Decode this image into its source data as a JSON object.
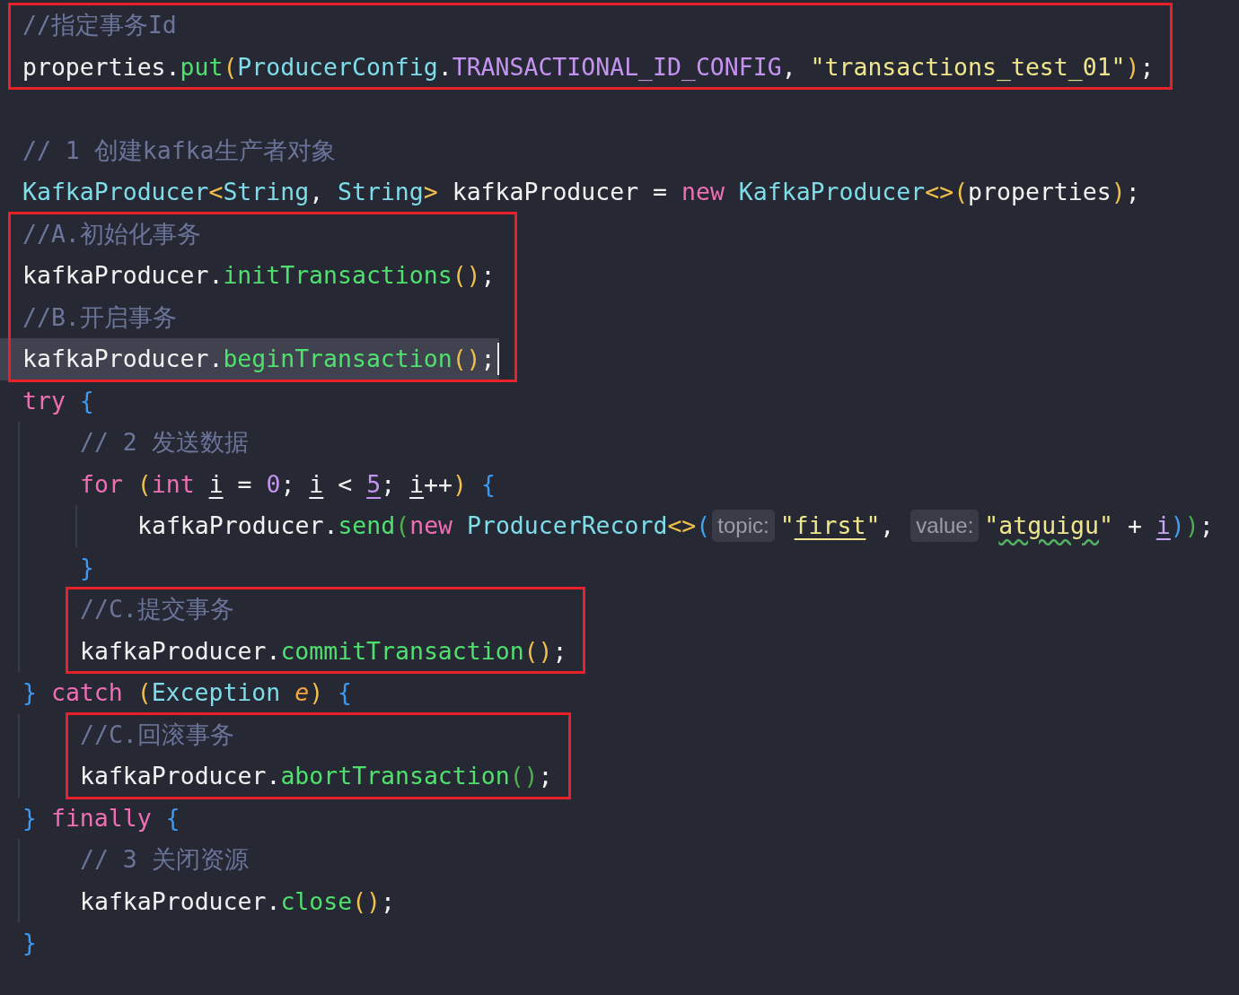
{
  "editor": {
    "nodes": [
      {
        "kind": "boxed",
        "lines": [
          {
            "kind": "line",
            "tokens": [
              {
                "kind": "comment",
                "text": "//指定事务Id"
              }
            ]
          },
          {
            "kind": "line",
            "tokens": [
              {
                "kind": "plain",
                "text": "properties."
              },
              {
                "kind": "method",
                "text": "put"
              },
              {
                "kind": "paren",
                "text": "("
              },
              {
                "kind": "type",
                "text": "ProducerConfig"
              },
              {
                "kind": "plain",
                "text": "."
              },
              {
                "kind": "const",
                "text": "TRANSACTIONAL_ID_CONFIG"
              },
              {
                "kind": "plain",
                "text": ", "
              },
              {
                "kind": "string",
                "text": "\"transactions_test_01\""
              },
              {
                "kind": "paren",
                "text": ")"
              },
              {
                "kind": "plain",
                "text": ";"
              }
            ]
          }
        ]
      },
      {
        "kind": "blank"
      },
      {
        "kind": "line",
        "tokens": [
          {
            "kind": "comment",
            "text": "// 1 创建kafka生产者对象"
          }
        ]
      },
      {
        "kind": "line",
        "tokens": [
          {
            "kind": "type",
            "text": "KafkaProducer"
          },
          {
            "kind": "paren",
            "text": "<"
          },
          {
            "kind": "type",
            "text": "String"
          },
          {
            "kind": "plain",
            "text": ", "
          },
          {
            "kind": "type",
            "text": "String"
          },
          {
            "kind": "paren",
            "text": ">"
          },
          {
            "kind": "plain",
            "text": " kafkaProducer = "
          },
          {
            "kind": "keyword",
            "text": "new"
          },
          {
            "kind": "type",
            "text": " KafkaProducer"
          },
          {
            "kind": "paren",
            "text": "<>("
          },
          {
            "kind": "plain",
            "text": "properties"
          },
          {
            "kind": "paren",
            "text": ")"
          },
          {
            "kind": "plain",
            "text": ";"
          }
        ]
      },
      {
        "kind": "boxed",
        "lines": [
          {
            "kind": "line",
            "tokens": [
              {
                "kind": "comment",
                "text": "//A.初始化事务"
              }
            ]
          },
          {
            "kind": "line",
            "tokens": [
              {
                "kind": "plain",
                "text": "kafkaProducer."
              },
              {
                "kind": "method",
                "text": "initTransactions"
              },
              {
                "kind": "paren",
                "text": "()"
              },
              {
                "kind": "plain",
                "text": ";"
              }
            ]
          },
          {
            "kind": "line",
            "tokens": [
              {
                "kind": "comment",
                "text": "//B.开启事务"
              }
            ]
          },
          {
            "kind": "line",
            "current": true,
            "cursor": true,
            "tokens": [
              {
                "kind": "plain",
                "text": "kafkaProducer."
              },
              {
                "kind": "method",
                "text": "beginTransaction"
              },
              {
                "kind": "paren",
                "text": "()"
              },
              {
                "kind": "plain",
                "text": ";"
              }
            ]
          }
        ]
      },
      {
        "kind": "line",
        "tokens": [
          {
            "kind": "keyword",
            "text": "try"
          },
          {
            "kind": "brace",
            "text": " {"
          }
        ],
        "children": [
          {
            "kind": "line",
            "tokens": [
              {
                "kind": "comment",
                "text": "// 2 发送数据"
              }
            ]
          },
          {
            "kind": "line",
            "tokens": [
              {
                "kind": "keyword",
                "text": "for"
              },
              {
                "kind": "paren",
                "text": " ("
              },
              {
                "kind": "keyword",
                "text": "int "
              },
              {
                "kind": "var",
                "text": "i",
                "underlined": true
              },
              {
                "kind": "plain",
                "text": " = "
              },
              {
                "kind": "number",
                "text": "0"
              },
              {
                "kind": "plain",
                "text": "; "
              },
              {
                "kind": "var",
                "text": "i",
                "underlined": true
              },
              {
                "kind": "plain",
                "text": " < "
              },
              {
                "kind": "number",
                "text": "5",
                "underlined": true
              },
              {
                "kind": "plain",
                "text": "; "
              },
              {
                "kind": "var",
                "text": "i",
                "underlined": true
              },
              {
                "kind": "plain",
                "text": "++"
              },
              {
                "kind": "paren",
                "text": ")"
              },
              {
                "kind": "brace",
                "text": " {"
              }
            ],
            "children": [
              {
                "kind": "line",
                "tokens": [
                  {
                    "kind": "plain",
                    "text": "kafkaProducer."
                  },
                  {
                    "kind": "method",
                    "text": "send"
                  },
                  {
                    "kind": "paren-green",
                    "text": "("
                  },
                  {
                    "kind": "keyword",
                    "text": "new"
                  },
                  {
                    "kind": "type",
                    "text": " ProducerRecord"
                  },
                  {
                    "kind": "paren",
                    "text": "<>"
                  },
                  {
                    "kind": "paren-blue",
                    "text": "("
                  },
                  {
                    "kind": "hint",
                    "text": "topic:"
                  },
                  {
                    "kind": "string",
                    "text": "\""
                  },
                  {
                    "kind": "string",
                    "text": "first",
                    "underlined": true
                  },
                  {
                    "kind": "string",
                    "text": "\""
                  },
                  {
                    "kind": "plain",
                    "text": ", "
                  },
                  {
                    "kind": "hint",
                    "text": "value:"
                  },
                  {
                    "kind": "string",
                    "text": "\""
                  },
                  {
                    "kind": "string",
                    "text": "atguigu",
                    "typo": true
                  },
                  {
                    "kind": "string",
                    "text": "\""
                  },
                  {
                    "kind": "plain",
                    "text": " + "
                  },
                  {
                    "kind": "local",
                    "text": "i",
                    "underlined": true
                  },
                  {
                    "kind": "paren-blue",
                    "text": ")"
                  },
                  {
                    "kind": "paren-green",
                    "text": ")"
                  },
                  {
                    "kind": "plain",
                    "text": ";"
                  }
                ]
              }
            ]
          },
          {
            "kind": "line",
            "tokens": [
              {
                "kind": "brace",
                "text": "}"
              }
            ]
          },
          {
            "kind": "boxed",
            "lines": [
              {
                "kind": "line",
                "tokens": [
                  {
                    "kind": "comment",
                    "text": "//C.提交事务"
                  }
                ]
              },
              {
                "kind": "line",
                "tokens": [
                  {
                    "kind": "plain",
                    "text": "kafkaProducer."
                  },
                  {
                    "kind": "method",
                    "text": "commitTransaction"
                  },
                  {
                    "kind": "paren",
                    "text": "()"
                  },
                  {
                    "kind": "plain",
                    "text": ";"
                  }
                ]
              }
            ]
          }
        ]
      },
      {
        "kind": "line",
        "tokens": [
          {
            "kind": "brace",
            "text": "}"
          },
          {
            "kind": "keyword",
            "text": " catch"
          },
          {
            "kind": "paren",
            "text": " ("
          },
          {
            "kind": "type",
            "text": "Exception "
          },
          {
            "kind": "param",
            "text": "e"
          },
          {
            "kind": "paren",
            "text": ")"
          },
          {
            "kind": "brace",
            "text": " {"
          }
        ],
        "children": [
          {
            "kind": "boxed",
            "lines": [
              {
                "kind": "line",
                "tokens": [
                  {
                    "kind": "comment",
                    "text": "//C.回滚事务"
                  }
                ]
              },
              {
                "kind": "line",
                "tokens": [
                  {
                    "kind": "plain",
                    "text": "kafkaProducer."
                  },
                  {
                    "kind": "method",
                    "text": "abortTransaction"
                  },
                  {
                    "kind": "paren-green",
                    "text": "()"
                  },
                  {
                    "kind": "plain",
                    "text": ";"
                  }
                ]
              }
            ]
          }
        ]
      },
      {
        "kind": "line",
        "tokens": [
          {
            "kind": "brace",
            "text": "}"
          },
          {
            "kind": "keyword",
            "text": " finally"
          },
          {
            "kind": "brace",
            "text": " {"
          }
        ],
        "children": [
          {
            "kind": "line",
            "tokens": [
              {
                "kind": "comment",
                "text": "// 3 关闭资源"
              }
            ]
          },
          {
            "kind": "line",
            "tokens": [
              {
                "kind": "plain",
                "text": "kafkaProducer."
              },
              {
                "kind": "method",
                "text": "close"
              },
              {
                "kind": "paren",
                "text": "()"
              },
              {
                "kind": "plain",
                "text": ";"
              }
            ]
          }
        ]
      },
      {
        "kind": "line",
        "tokens": [
          {
            "kind": "brace",
            "text": "}"
          }
        ]
      }
    ]
  }
}
